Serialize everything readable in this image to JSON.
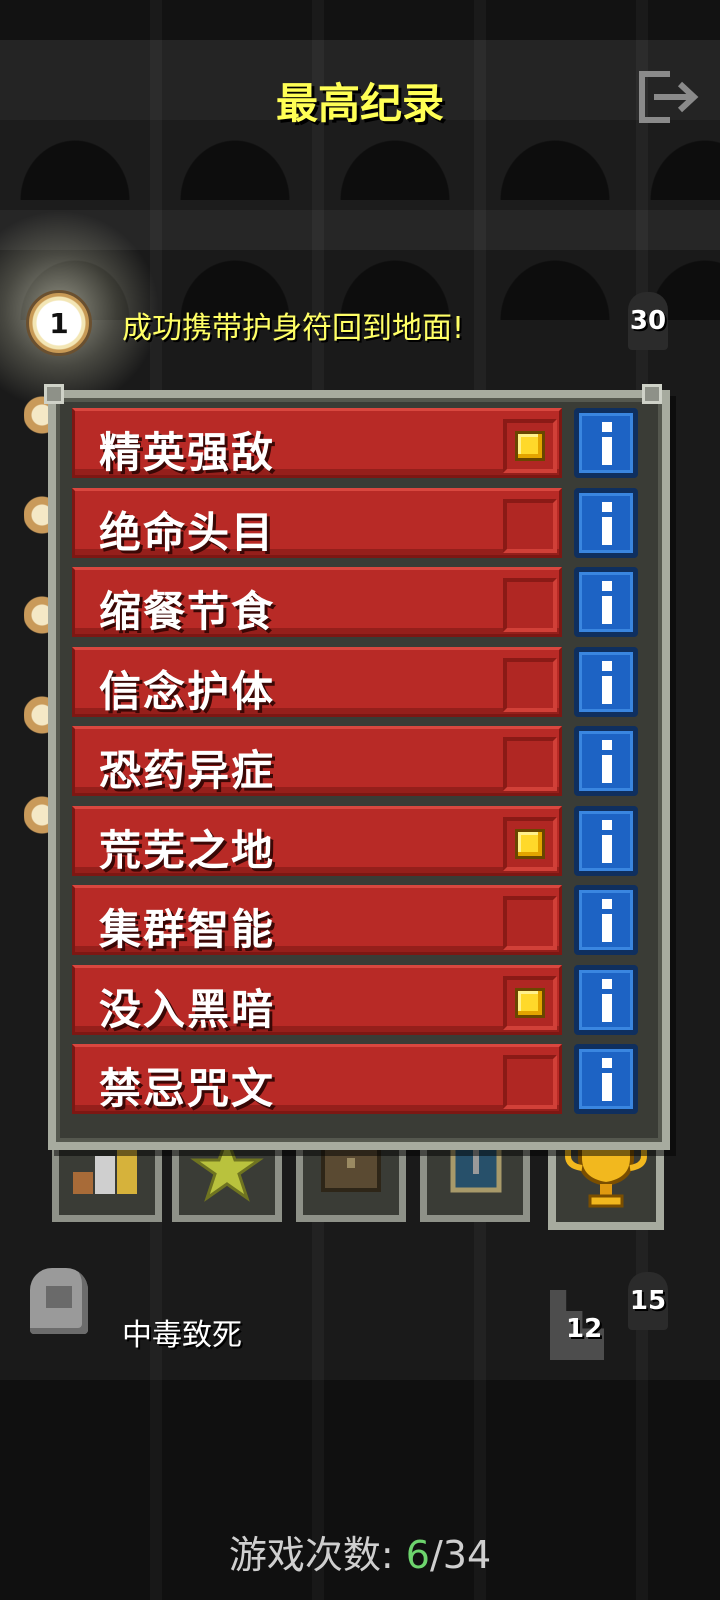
{
  "header": {
    "title": "最高纪录"
  },
  "top_record": {
    "rank": "1",
    "description": "成功携带护身符回到地面!",
    "depth": "30"
  },
  "challenges": [
    {
      "label": "精英强敌",
      "enabled": true
    },
    {
      "label": "绝命头目",
      "enabled": false
    },
    {
      "label": "缩餐节食",
      "enabled": false
    },
    {
      "label": "信念护体",
      "enabled": false
    },
    {
      "label": "恐药异症",
      "enabled": false
    },
    {
      "label": "荒芜之地",
      "enabled": true
    },
    {
      "label": "集群智能",
      "enabled": false
    },
    {
      "label": "没入黑暗",
      "enabled": true
    },
    {
      "label": "禁忌咒文",
      "enabled": false
    }
  ],
  "bottom_record": {
    "description": "中毒致死",
    "level": "12",
    "depth": "15"
  },
  "footer": {
    "label": "游戏次数:",
    "current": "6",
    "total": "/34"
  },
  "colors": {
    "title": "#ffff55",
    "challenge_bar": "#b82a26",
    "info_button": "#1d63c4",
    "checkbox_on": "#ffd92a",
    "games_current": "#6dd46d"
  },
  "icons": {
    "exit": "exit-icon",
    "tabs": [
      "bars-icon",
      "star-icon",
      "chest-icon",
      "badge-icon",
      "trophy-icon"
    ]
  }
}
